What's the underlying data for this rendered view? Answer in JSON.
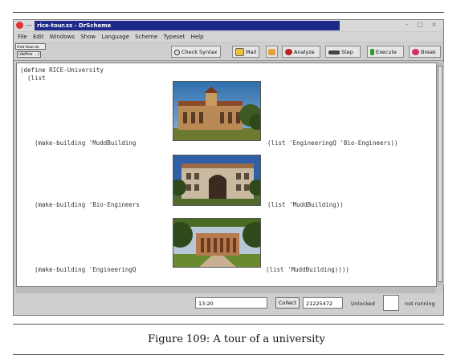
{
  "window": {
    "title": "rice-tour.ss - DrScheme",
    "filename": "rice-tour.ss",
    "define_button": "(define ...)"
  },
  "menu": [
    "File",
    "Edit",
    "Windows",
    "Show",
    "Language",
    "Scheme",
    "Typeset",
    "Help"
  ],
  "toolbar": {
    "check_syntax": "Check Syntax",
    "mail": "Mail",
    "analyze": "Analyze",
    "step": "Step",
    "execute": "Execute",
    "break": "Break"
  },
  "editor": {
    "line1": "(define RICE-University",
    "line2": "  (list",
    "rows": [
      {
        "left": "(make-building 'MuddBuilding",
        "right": "(list 'EngineeringQ 'Bio-Engineers))"
      },
      {
        "left": "(make-building 'Bio-Engineers",
        "right": "(list 'MuddBuilding))"
      },
      {
        "left": "(make-building 'EngineeringQ",
        "right": "(list 'MuddBuilding))))"
      }
    ]
  },
  "status": {
    "time": "13:20",
    "collect": "Collect",
    "memory": "21225472",
    "lock_state": "Unlocked",
    "run_state": "not running"
  },
  "caption": "Figure 109: A tour of a university"
}
